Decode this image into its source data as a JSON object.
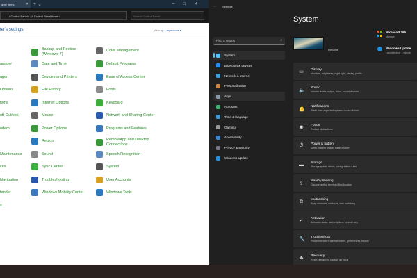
{
  "control_panel": {
    "tab_title": "anel Items",
    "breadcrumb": [
      "Control Panel",
      "All Control Panel Items"
    ],
    "search_placeholder": "Search Control Panel",
    "heading": "ter's settings",
    "view_by_label": "View by:",
    "view_by_value": "Large icons ▾",
    "left_partial": [
      "anager",
      "ager",
      "Options",
      "tions",
      "oft Outlook)",
      "odem",
      "",
      "Maintenance",
      "ces",
      "Navigation",
      "fender",
      "s"
    ],
    "col2": [
      "Backup and Restore (Windows 7)",
      "Date and Time",
      "Devices and Printers",
      "File History",
      "Internet Options",
      "Mouse",
      "Power Options",
      "Region",
      "Sound",
      "Sync Center",
      "Troubleshooting",
      "Windows Mobility Center"
    ],
    "col3": [
      "Color Management",
      "Default Programs",
      "Ease of Access Center",
      "Fonts",
      "Keyboard",
      "Network and Sharing Center",
      "Programs and Features",
      "RemoteApp and Desktop Connections",
      "Speech Recognition",
      "System",
      "User Accounts",
      "Windows Tools"
    ]
  },
  "settings": {
    "title": "Settings",
    "search_placeholder": "Find a setting",
    "nav": [
      "System",
      "Bluetooth & devices",
      "Network & internet",
      "Personalization",
      "Apps",
      "Accounts",
      "Time & language",
      "Gaming",
      "Accessibility",
      "Privacy & security",
      "Windows Update"
    ],
    "nav_colors": [
      "#4cc2ff",
      "#1e90ff",
      "#3aa0e0",
      "#d08a40",
      "#8899aa",
      "#3cb371",
      "#3a9ad9",
      "#999",
      "#3a8ad9",
      "#778",
      "#2a90d9"
    ],
    "page_title": "System",
    "rename": "Rename",
    "m365": {
      "title": "Microsoft 365",
      "sub": "Manage"
    },
    "wu": {
      "title": "Windows Update",
      "sub": "Last checked: 1 minute"
    },
    "cards": [
      {
        "title": "Display",
        "sub": "Monitors, brightness, night light, display profile",
        "icon": "▭"
      },
      {
        "title": "Sound",
        "sub": "Volume levels, output, input, sound devices",
        "icon": "🔈"
      },
      {
        "title": "Notifications",
        "sub": "Alerts from apps and system, do not disturb",
        "icon": "🔔"
      },
      {
        "title": "Focus",
        "sub": "Reduce distractions",
        "icon": "◉"
      },
      {
        "title": "Power & battery",
        "sub": "Sleep, battery usage, battery saver",
        "icon": "⏻"
      },
      {
        "title": "Storage",
        "sub": "Storage space, drives, configuration rules",
        "icon": "▬"
      },
      {
        "title": "Nearby sharing",
        "sub": "Discoverability, received files location",
        "icon": "⇪"
      },
      {
        "title": "Multitasking",
        "sub": "Snap windows, desktops, task switching",
        "icon": "⧉"
      },
      {
        "title": "Activation",
        "sub": "Activation state, subscriptions, product key",
        "icon": "✓"
      },
      {
        "title": "Troubleshoot",
        "sub": "Recommended troubleshooters, preferences, history",
        "icon": "🔧"
      },
      {
        "title": "Recovery",
        "sub": "Reset, advanced startup, go back",
        "icon": "⏏"
      }
    ]
  }
}
